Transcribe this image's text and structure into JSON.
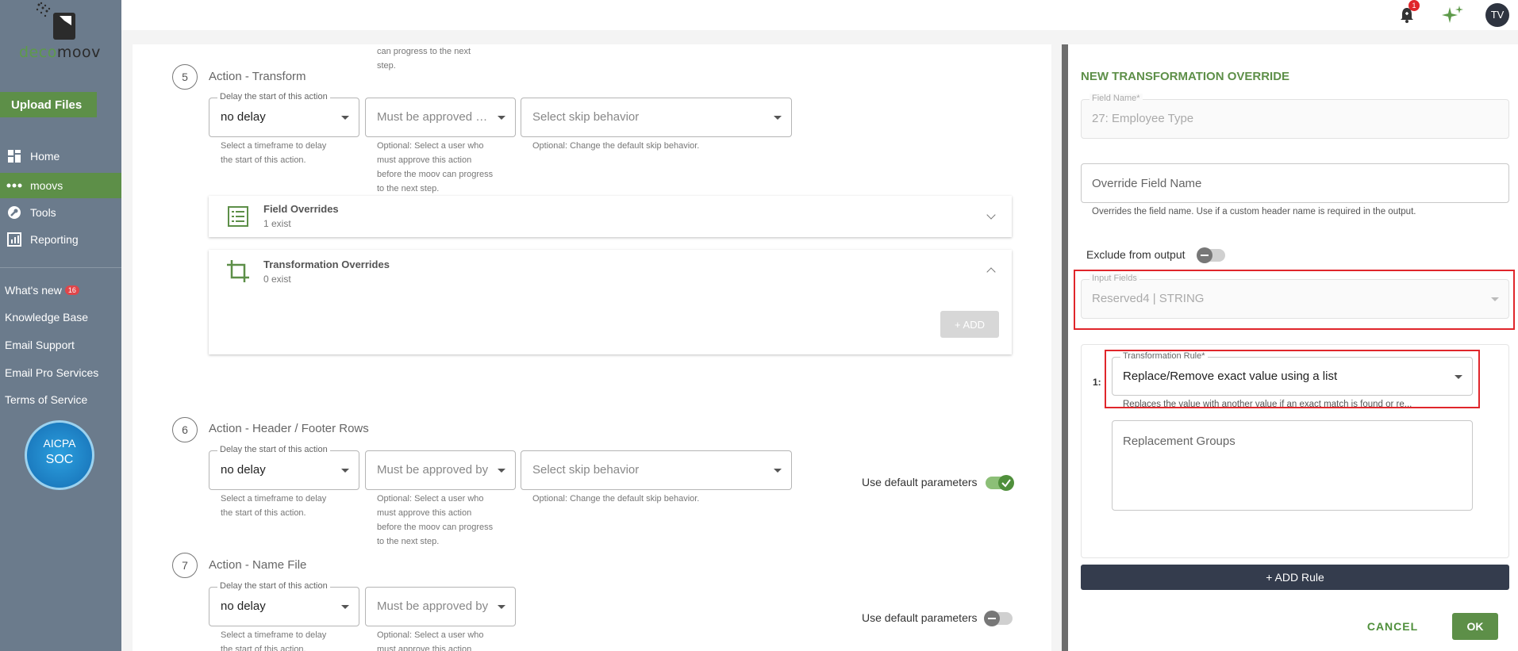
{
  "sidebar": {
    "logo_text_a": "deco",
    "logo_text_b": "moov",
    "upload_label": "Upload Files",
    "nav": [
      {
        "label": "Home",
        "icon": "home-icon"
      },
      {
        "label": "moovs",
        "icon": "dots-icon"
      },
      {
        "label": "Tools",
        "icon": "wrench-icon"
      },
      {
        "label": "Reporting",
        "icon": "chart-icon"
      }
    ],
    "links": {
      "whats_new": "What's new",
      "whats_new_badge": "16",
      "knowledge_base": "Knowledge Base",
      "email_support": "Email Support",
      "email_pro": "Email Pro Services",
      "terms": "Terms of Service"
    },
    "soc_line1": "AICPA",
    "soc_line2": "SOC"
  },
  "topbar": {
    "bell_count": "1",
    "avatar": "TV"
  },
  "steps": [
    {
      "number": "5",
      "title": "Action - Transform",
      "delay_label": "Delay the start of this action",
      "delay_value": "no delay",
      "delay_help": "Select a timeframe to delay the start of this action.",
      "approve_placeholder": "Must be approved by...",
      "approve_help": "Optional: Select a user who must approve this action before the moov can progress to the next step.",
      "skip_placeholder": "Select skip behavior",
      "skip_help": "Optional: Change the default skip behavior."
    },
    {
      "number": "6",
      "title": "Action - Header / Footer Rows",
      "delay_label": "Delay the start of this action",
      "delay_value": "no delay",
      "delay_help": "Select a timeframe to delay the start of this action.",
      "approve_placeholder": "Must be approved by...",
      "approve_help": "Optional: Select a user who must approve this action before the moov can progress to the next step.",
      "skip_placeholder": "Select skip behavior",
      "skip_help": "Optional: Change the default skip behavior.",
      "default_params_label": "Use default parameters",
      "default_params_on": true
    },
    {
      "number": "7",
      "title": "Action - Name File",
      "delay_label": "Delay the start of this action",
      "delay_value": "no delay",
      "delay_help": "Select a timeframe to delay the start of this action.",
      "approve_placeholder": "Must be approved by...",
      "approve_help": "Optional: Select a user who must approve this action before the moov can progress to the next step.",
      "default_params_label": "Use default parameters",
      "default_params_on": false
    }
  ],
  "top_clipped_help": "can progress to the next step.",
  "field_overrides": {
    "title": "Field Overrides",
    "sub": "1 exist"
  },
  "transformation_overrides": {
    "title": "Transformation Overrides",
    "sub": "0 exist",
    "add_label": "+ ADD"
  },
  "panel": {
    "title": "NEW TRANSFORMATION OVERRIDE",
    "field_name_label": "Field Name*",
    "field_name_value": "27: Employee Type",
    "override_placeholder": "Override Field Name",
    "override_help": "Overrides the field name. Use if a custom header name is required in the output.",
    "exclude_label": "Exclude from output",
    "input_fields_label": "Input Fields",
    "input_fields_value": "Reserved4 | STRING",
    "rule_number": "1:",
    "rule_label": "Transformation Rule*",
    "rule_value": "Replace/Remove exact value using a list",
    "rule_help": "Replaces the value with another value if an exact match is found or re...",
    "replacement_placeholder": "Replacement Groups",
    "add_rule_label": "+ ADD Rule",
    "cancel_label": "CANCEL",
    "ok_label": "OK"
  }
}
